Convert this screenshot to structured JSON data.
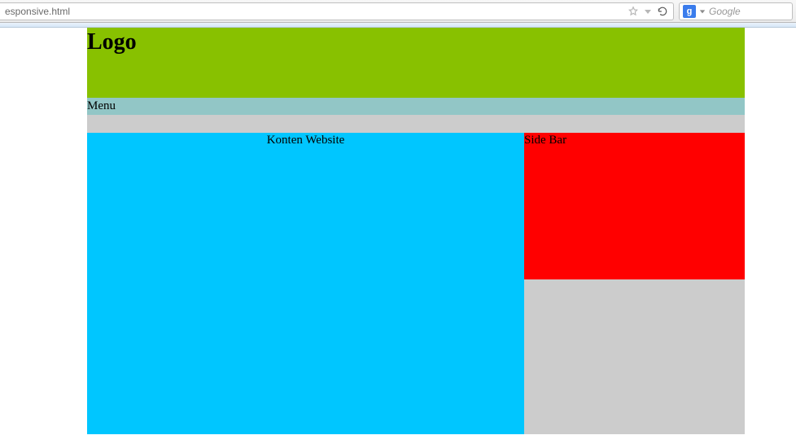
{
  "browser": {
    "address_fragment": "esponsive.html",
    "search_placeholder": "Google",
    "search_engine_initial": "g"
  },
  "header": {
    "logo_text": "Logo"
  },
  "nav": {
    "label": "Menu"
  },
  "content": {
    "title": "Konten Website"
  },
  "sidebar": {
    "title": "Side Bar"
  }
}
